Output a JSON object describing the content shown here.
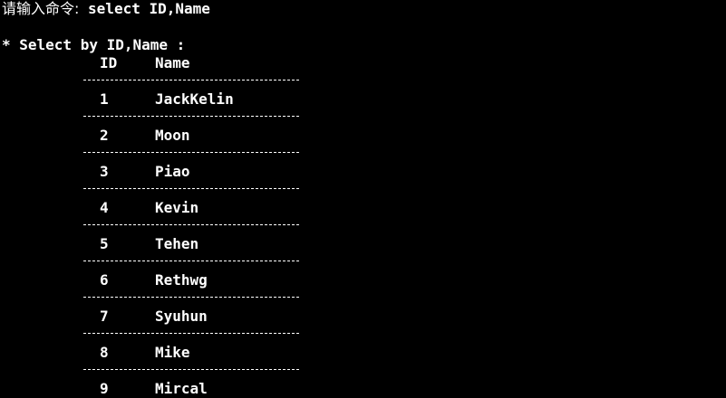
{
  "console": {
    "prompt_label": "请输入命令:",
    "command": " select ID,Name",
    "result_title": "* Select by ID,Name :"
  },
  "table": {
    "headers": [
      "ID",
      "Name"
    ],
    "rows": [
      [
        "1",
        "JackKelin"
      ],
      [
        "2",
        "Moon"
      ],
      [
        "3",
        "Piao"
      ],
      [
        "4",
        "Kevin"
      ],
      [
        "5",
        "Tehen"
      ],
      [
        "6",
        "Rethwg"
      ],
      [
        "7",
        "Syuhun"
      ],
      [
        "8",
        "Mike"
      ],
      [
        "9",
        "Mircal"
      ]
    ]
  },
  "colors": {
    "background": "#000000",
    "text": "#ffffff"
  }
}
